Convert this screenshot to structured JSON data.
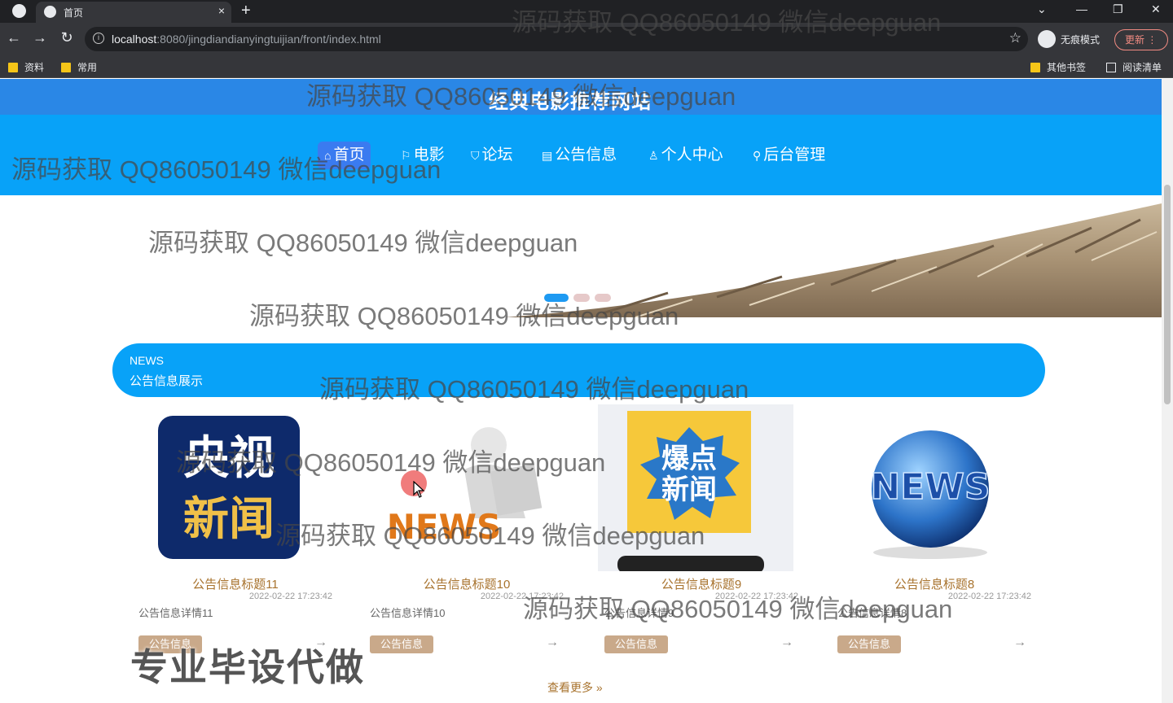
{
  "browser": {
    "tab_title": "首页",
    "tab_close": "×",
    "new_tab": "+",
    "url_host": "localhost",
    "url_path": ":8080/jingdiandianyingtuijian/front/index.html",
    "incognito_label": "无痕模式",
    "update_label": "更新",
    "bookmarks": [
      "资料",
      "常用"
    ],
    "bookmarks_right": [
      "其他书签",
      "阅读清单"
    ],
    "window_controls": [
      "⌄",
      "—",
      "❐",
      "✕"
    ]
  },
  "site": {
    "title": "经典电影推荐网站",
    "nav": [
      {
        "icon": "⌂",
        "label": "首页"
      },
      {
        "icon": "⚐",
        "label": "电影"
      },
      {
        "icon": "⛉",
        "label": "论坛"
      },
      {
        "icon": "▤",
        "label": "公告信息"
      },
      {
        "icon": "♙",
        "label": "个人中心"
      },
      {
        "icon": "⚲",
        "label": "后台管理"
      }
    ]
  },
  "news_section": {
    "heading_en": "NEWS",
    "heading_cn": "公告信息展示"
  },
  "cards": [
    {
      "title": "公告信息标题11",
      "time": "2022-02-22 17:23:42",
      "desc": "公告信息详情11",
      "tag": "公告信息",
      "arrow": "→",
      "image_text": [
        "央视",
        "新闻"
      ]
    },
    {
      "title": "公告信息标题10",
      "time": "2022-02-22 17:23:42",
      "desc": "公告信息详情10",
      "tag": "公告信息",
      "arrow": "→",
      "image_text": [
        "NEWS"
      ]
    },
    {
      "title": "公告信息标题9",
      "time": "2022-02-22 17:23:42",
      "desc": "公告信息详情9",
      "tag": "公告信息",
      "arrow": "→",
      "image_text": [
        "爆点",
        "新闻"
      ]
    },
    {
      "title": "公告信息标题8",
      "time": "2022-02-22 17:23:42",
      "desc": "公告信息详情8",
      "tag": "公告信息",
      "arrow": "→",
      "image_text": [
        "NEWS"
      ]
    }
  ],
  "more_label": "查看更多 »",
  "overlay": {
    "watermark": "源码获取 QQ86050149 微信deepguan",
    "stamp": "专业毕设代做"
  },
  "colors": {
    "nav_blue": "#08a2f8",
    "title_bar": "#2a87e6",
    "accent_gold": "#a8732e",
    "tag_bg": "#c9a98a"
  }
}
